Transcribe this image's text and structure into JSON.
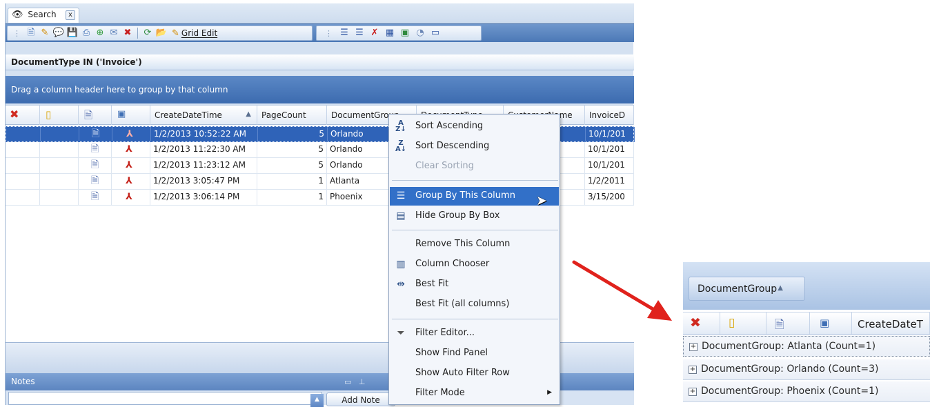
{
  "tab": {
    "title": "Search",
    "close": "x"
  },
  "toolbar": {
    "grid_edit_label": "Grid Edit"
  },
  "filter": {
    "text": "DocumentType IN ('Invoice')"
  },
  "group_panel": {
    "hint": "Drag a column header here to group by that column"
  },
  "grid": {
    "columns": [
      "CreateDateTime",
      "PageCount",
      "DocumentGroup",
      "DocumentType",
      "CustomerName",
      "InvoiceD"
    ],
    "sort_indicator": "▲",
    "rows": [
      {
        "create": "1/2/2013 10:52:22 AM",
        "pages": "5",
        "group": "Orlando",
        "invoice": "10/1/201",
        "selected": true
      },
      {
        "create": "1/2/2013 11:22:30 AM",
        "pages": "5",
        "group": "Orlando",
        "invoice": "10/1/201"
      },
      {
        "create": "1/2/2013 11:23:12 AM",
        "pages": "5",
        "group": "Orlando",
        "invoice": "10/1/201"
      },
      {
        "create": "1/2/2013 3:05:47 PM",
        "pages": "1",
        "group": "Atlanta",
        "invoice": "1/2/2011"
      },
      {
        "create": "1/2/2013 3:06:14 PM",
        "pages": "1",
        "group": "Phoenix",
        "invoice": "3/15/200"
      }
    ]
  },
  "context_menu": {
    "items": [
      {
        "label": "Sort Ascending",
        "icon": "sort-ascending-icon"
      },
      {
        "label": "Sort Descending",
        "icon": "sort-descending-icon"
      },
      {
        "label": "Clear Sorting",
        "disabled": true
      },
      {
        "label": "Group By This Column",
        "icon": "group-by-icon",
        "highlighted": true
      },
      {
        "label": "Hide Group By Box",
        "icon": "group-box-icon"
      },
      {
        "label": "Remove This Column"
      },
      {
        "label": "Column Chooser",
        "icon": "column-chooser-icon"
      },
      {
        "label": "Best Fit",
        "icon": "best-fit-icon"
      },
      {
        "label": "Best Fit (all columns)"
      },
      {
        "label": "Filter Editor...",
        "icon": "funnel-icon"
      },
      {
        "label": "Show Find Panel"
      },
      {
        "label": "Show Auto Filter Row"
      },
      {
        "label": "Filter Mode",
        "submenu": true
      }
    ]
  },
  "notes": {
    "title": "Notes",
    "add_note_label": "Add Note"
  },
  "inset": {
    "group_chip": "DocumentGroup",
    "header_col": "CreateDateT",
    "group_rows": [
      "DocumentGroup: Atlanta (Count=1)",
      "DocumentGroup: Orlando (Count=3)",
      "DocumentGroup: Phoenix (Count=1)"
    ]
  },
  "colors": {
    "accent": "#3270c8",
    "selection": "#2f63b8",
    "arrow": "#e0221c",
    "header_band": "#4b78b6"
  }
}
